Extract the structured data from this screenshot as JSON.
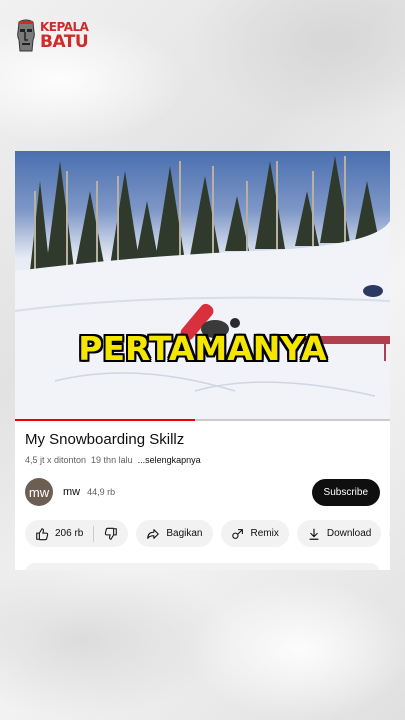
{
  "logo": {
    "line1": "KEPALA",
    "line2": "BATU"
  },
  "video": {
    "caption": "PERTAMANYA",
    "progress_fraction": 0.48
  },
  "title": "My Snowboarding Skillz",
  "meta": {
    "views": "4,5 jt x ditonton",
    "age": "19 thn lalu",
    "more": "...selengkapnya"
  },
  "channel": {
    "avatar_text": "mw",
    "name": "mw",
    "subscribers": "44,9 rb",
    "subscribe_label": "Subscribe"
  },
  "actions": {
    "likes": "206 rb",
    "share": "Bagikan",
    "remix": "Remix",
    "download": "Download"
  },
  "colors": {
    "accent_red": "#e00000",
    "caption_yellow": "#f5e600",
    "logo_red": "#d02b2b"
  }
}
